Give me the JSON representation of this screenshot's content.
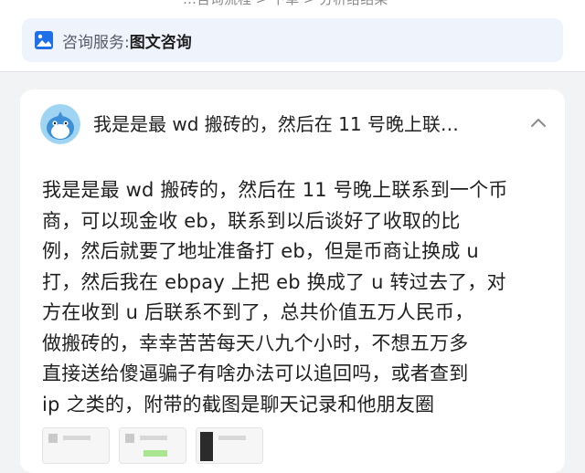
{
  "breadcrumb": {
    "text": "…咨询流程 > 下单 > 分析给结果"
  },
  "service": {
    "label": "咨询服务:",
    "value": "图文咨询",
    "icon": "image-icon",
    "accent": "#1e6fe8"
  },
  "question": {
    "title": "我是是最 wd 搬砖的，然后在 11 号晚上联…",
    "body_lines": [
      "我是是最 wd 搬砖的，然后在 11 号晚上联系到一个币",
      "商，可以现金收 eb，联系到以后谈好了收取的比",
      "例，然后就要了地址准备打 eb，但是币商让换成 u",
      "打，然后我在 ebpay 上把 eb 换成了 u 转过去了，对",
      "方在收到 u 后联系不到了，总共价值五万人民币，",
      "做搬砖的，幸幸苦苦每天八九个小时，不想五万多",
      "直接送给傻逼骗子有啥办法可以追回吗，或者查到",
      "ip 之类的，附带的截图是聊天记录和他朋友圈"
    ],
    "collapse_icon": "chevron-up-icon",
    "avatar_icon": "shark-avatar-icon"
  },
  "attachments": [
    {
      "name": "chat-screenshot-1"
    },
    {
      "name": "chat-screenshot-2"
    },
    {
      "name": "moments-screenshot"
    }
  ]
}
